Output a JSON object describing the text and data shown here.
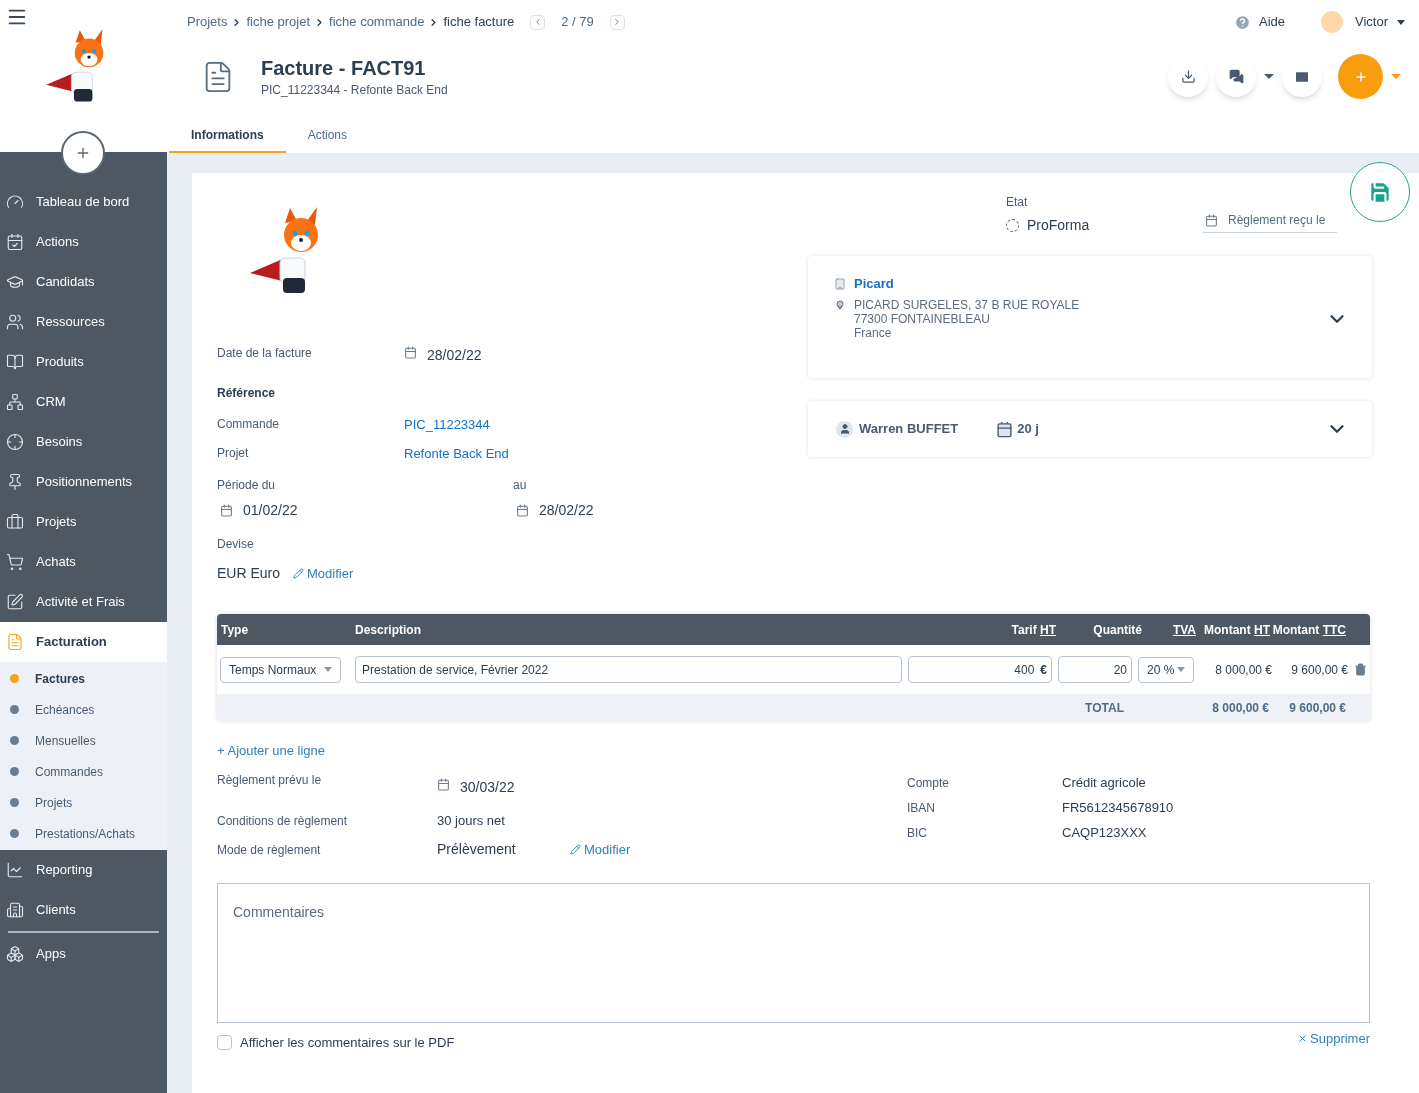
{
  "breadcrumb": [
    {
      "label": "Projets",
      "current": false
    },
    {
      "label": "fiche projet",
      "current": false
    },
    {
      "label": "fiche commande",
      "current": false
    },
    {
      "label": "fiche facture",
      "current": true
    }
  ],
  "pager": {
    "text": "2 / 79"
  },
  "topbar": {
    "help": "Aide",
    "user": "Victor"
  },
  "header": {
    "title": "Facture - FACT91",
    "subtitle": "PIC_11223344 - Refonte Back End"
  },
  "tabs": [
    {
      "label": "Informations",
      "selected": true
    },
    {
      "label": "Actions",
      "selected": false
    }
  ],
  "sidebar": {
    "items": [
      {
        "label": "Tableau de bord",
        "active": false
      },
      {
        "label": "Actions",
        "active": false
      },
      {
        "label": "Candidats",
        "active": false
      },
      {
        "label": "Ressources",
        "active": false
      },
      {
        "label": "Produits",
        "active": false
      },
      {
        "label": "CRM",
        "active": false
      },
      {
        "label": "Besoins",
        "active": false
      },
      {
        "label": "Positionnements",
        "active": false
      },
      {
        "label": "Projets",
        "active": false
      },
      {
        "label": "Achats",
        "active": false
      },
      {
        "label": "Activité et Frais",
        "active": false
      },
      {
        "label": "Facturation",
        "active": true,
        "children": [
          {
            "label": "Factures",
            "selected": true
          },
          {
            "label": "Echéances",
            "selected": false
          },
          {
            "label": "Mensuelles",
            "selected": false
          },
          {
            "label": "Commandes",
            "selected": false
          },
          {
            "label": "Projets",
            "selected": false
          },
          {
            "label": "Prestations/Achats",
            "selected": false
          }
        ]
      },
      {
        "label": "Reporting",
        "active": false
      },
      {
        "label": "Clients",
        "active": false
      },
      {
        "label": "Apps",
        "active": false
      }
    ]
  },
  "state": {
    "label": "Etat",
    "value": "ProForma",
    "payment_received": "Règlement reçu le"
  },
  "invoice": {
    "date_label": "Date de la facture",
    "date": "28/02/22",
    "reference_label": "Référence",
    "order_label": "Commande",
    "order": "PIC_11223344",
    "project_label": "Projet",
    "project": "Refonte Back End",
    "period_label": "Période du",
    "period_from": "01/02/22",
    "period_to_label": "au",
    "period_to": "28/02/22",
    "currency_label": "Devise",
    "currency": "EUR Euro",
    "modify": "Modifier"
  },
  "client": {
    "name": "Picard",
    "address": [
      "PICARD SURGELES, 37 B RUE ROYALE",
      "77300 FONTAINEBLEAU",
      "France"
    ],
    "expanded": false
  },
  "manager": {
    "name": "Warren BUFFET",
    "days": "20 j",
    "expanded": false
  },
  "table": {
    "columns": [
      {
        "label": "Type"
      },
      {
        "label": "Description"
      },
      {
        "label": "Tarif",
        "abbr": "HT"
      },
      {
        "label": "Quantité"
      },
      {
        "abbr": "TVA"
      },
      {
        "label": "Montant",
        "abbr": "HT"
      },
      {
        "label": "Montant",
        "abbr": "TTC"
      }
    ],
    "rows": [
      {
        "type": "Temps Normaux",
        "description": "Prestation de service, Février 2022",
        "rate": "400",
        "currency": "€",
        "quantity": "20",
        "vat": "20 %",
        "amount_ht": "8 000,00 €",
        "amount_ttc": "9 600,00 €"
      }
    ],
    "total": {
      "label": "TOTAL",
      "ht": "8 000,00 €",
      "ttc": "9 600,00 €"
    }
  },
  "add_line": "+ Ajouter une ligne",
  "payment": {
    "due_label": "Règlement prévu le",
    "due": "30/03/22",
    "terms_label": "Conditions de règlement",
    "terms": "30 jours net",
    "mode_label": "Mode de règlement",
    "mode": "Prélèvement",
    "modify": "Modifier"
  },
  "bank": [
    {
      "label": "Compte",
      "value": "Crédit agricole"
    },
    {
      "label": "IBAN",
      "value": "FR5612345678910"
    },
    {
      "label": "BIC",
      "value": "CAQP123XXX"
    }
  ],
  "comments": {
    "placeholder": "Commentaires"
  },
  "show_on_pdf": {
    "label": "Afficher les commentaires sur le PDF",
    "checked": false
  },
  "delete": "Supprimer"
}
